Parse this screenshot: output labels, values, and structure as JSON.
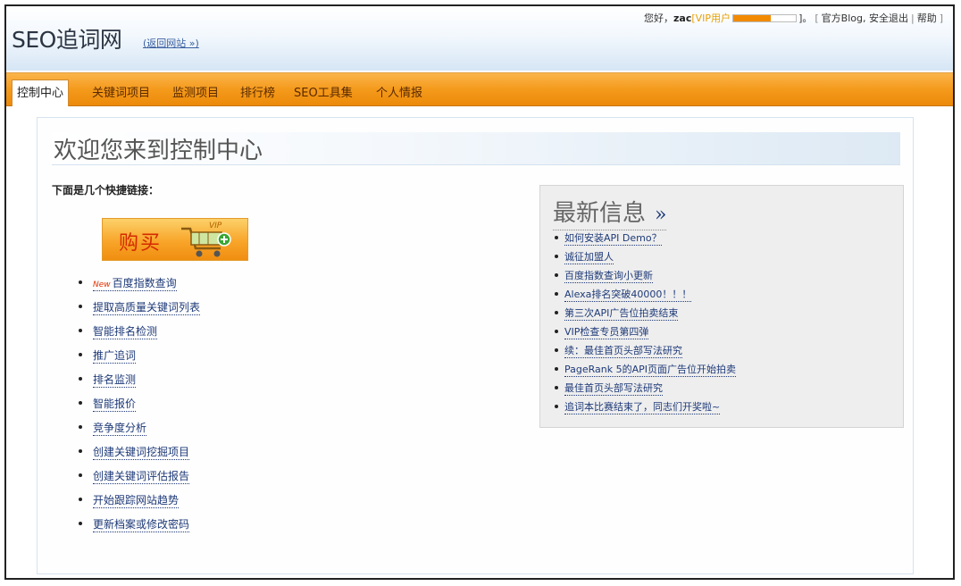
{
  "header": {
    "logo": "SEO追词网",
    "back_link": "(返回网站 »)",
    "userbar": {
      "greeting": "您好，",
      "username": "zac",
      "vip_label": "[VIP用户",
      "vip_close": "]。",
      "progress": 0.6,
      "blog": "官方Blog",
      "logout": "安全退出",
      "help": "帮助",
      "end": "]"
    }
  },
  "nav": {
    "items": [
      {
        "label": "控制中心",
        "active": true
      },
      {
        "label": "关键词项目",
        "active": false
      },
      {
        "label": "监测项目",
        "active": false
      },
      {
        "label": "排行榜",
        "active": false
      },
      {
        "label": "SEO工具集",
        "active": false
      },
      {
        "label": "个人情报",
        "active": false
      }
    ]
  },
  "main": {
    "welcome": "欢迎您来到控制中心",
    "quick_title": "下面是几个快捷链接：",
    "buy_button": {
      "label": "购买",
      "tag": "VIP"
    },
    "links": [
      {
        "label": "百度指数查询",
        "badge": "New"
      },
      {
        "label": "提取高质量关键词列表"
      },
      {
        "label": "智能排名检测"
      },
      {
        "label": "推广追词"
      },
      {
        "label": "排名监测"
      },
      {
        "label": "智能报价"
      },
      {
        "label": "竞争度分析"
      },
      {
        "label": "创建关键词挖掘项目"
      },
      {
        "label": "创建关键词评估报告"
      },
      {
        "label": "开始跟踪网站趋势"
      },
      {
        "label": "更新档案或修改密码"
      }
    ]
  },
  "news": {
    "title": "最新信息",
    "more": "»",
    "items": [
      "如何安装API Demo？",
      "诚征加盟人",
      "百度指数查询小更新",
      "Alexa排名突破40000！！！",
      "第三次API广告位拍卖结束",
      "VIP检查专员第四弹",
      "续：最佳首页头部写法研究",
      "PageRank 5的API页面广告位开始拍卖",
      "最佳首页头部写法研究",
      "追词本比赛结束了，同志们开奖啦~"
    ]
  }
}
